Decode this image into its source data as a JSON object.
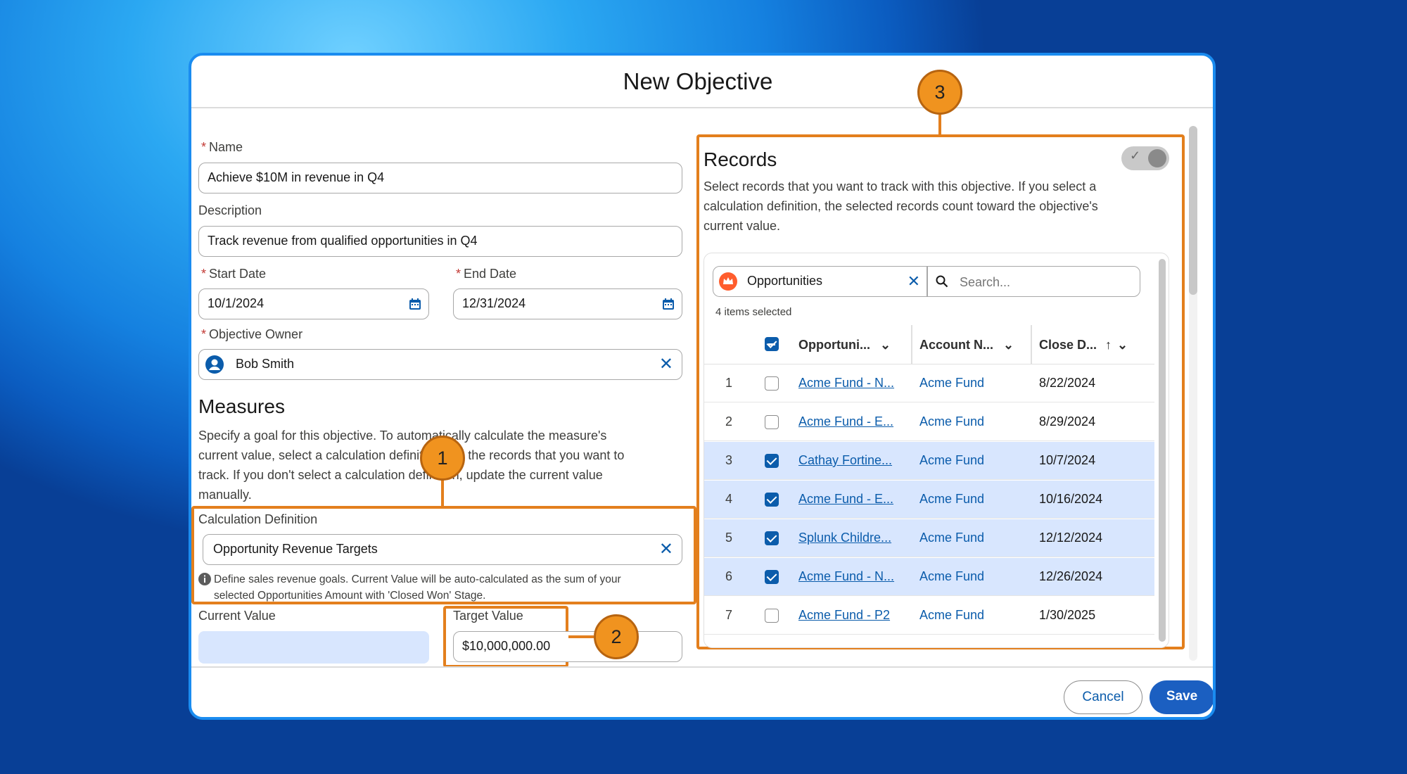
{
  "modal": {
    "title": "New Objective"
  },
  "form": {
    "name_label": "Name",
    "name_value": "Achieve $10M in revenue in Q4",
    "description_label": "Description",
    "description_value": "Track revenue from qualified opportunities in Q4",
    "start_date_label": "Start Date",
    "start_date_value": "10/1/2024",
    "end_date_label": "End Date",
    "end_date_value": "12/31/2024",
    "owner_label": "Objective Owner",
    "owner_value": "Bob Smith",
    "required_mark": "*"
  },
  "measures": {
    "heading": "Measures",
    "line1": "Specify a goal for this objective. To automatically calculate the measure's",
    "line2": "current value, select a calculation definition and the records that you want to",
    "line3": "track. If you don't select a calculation definition, update the current value",
    "line4": "manually.",
    "calc_label": "Calculation Definition",
    "calc_value": "Opportunity Revenue Targets",
    "calc_help_line1": "Define sales revenue goals. Current Value will be auto-calculated as the sum of your",
    "calc_help_line2": "selected Opportunities Amount with 'Closed Won' Stage.",
    "current_label": "Current Value",
    "current_value": "",
    "target_label": "Target Value",
    "target_value": "$10,000,000.00"
  },
  "records": {
    "title": "Records",
    "desc_line1": "Select records that you want to track with this objective. If you select a",
    "desc_line2": "calculation definition, the selected records count toward the objective's",
    "desc_line3": "current value.",
    "object_value": "Opportunities",
    "search_placeholder": "Search...",
    "selected_count": "4 items selected",
    "columns": [
      "Opportuni...",
      "Account N...",
      "Close D..."
    ],
    "rows": [
      {
        "num": "1",
        "checked": false,
        "name": "Acme Fund - N...",
        "account": "Acme Fund",
        "close": "8/22/2024"
      },
      {
        "num": "2",
        "checked": false,
        "name": "Acme Fund - E...",
        "account": "Acme Fund",
        "close": "8/29/2024"
      },
      {
        "num": "3",
        "checked": true,
        "name": "Cathay Fortine...",
        "account": "Acme Fund",
        "close": "10/7/2024"
      },
      {
        "num": "4",
        "checked": true,
        "name": "Acme Fund - E...",
        "account": "Acme Fund",
        "close": "10/16/2024"
      },
      {
        "num": "5",
        "checked": true,
        "name": "Splunk Childre...",
        "account": "Acme Fund",
        "close": "12/12/2024"
      },
      {
        "num": "6",
        "checked": true,
        "name": "Acme Fund - N...",
        "account": "Acme Fund",
        "close": "12/26/2024"
      },
      {
        "num": "7",
        "checked": false,
        "name": "Acme Fund - P2",
        "account": "Acme Fund",
        "close": "1/30/2025"
      }
    ]
  },
  "callouts": {
    "one": "1",
    "two": "2",
    "three": "3"
  },
  "footer": {
    "cancel": "Cancel",
    "save": "Save"
  },
  "colors": {
    "accent": "#0b5cab",
    "callout": "#e37f1d",
    "selected_row": "#d8e6fe"
  }
}
